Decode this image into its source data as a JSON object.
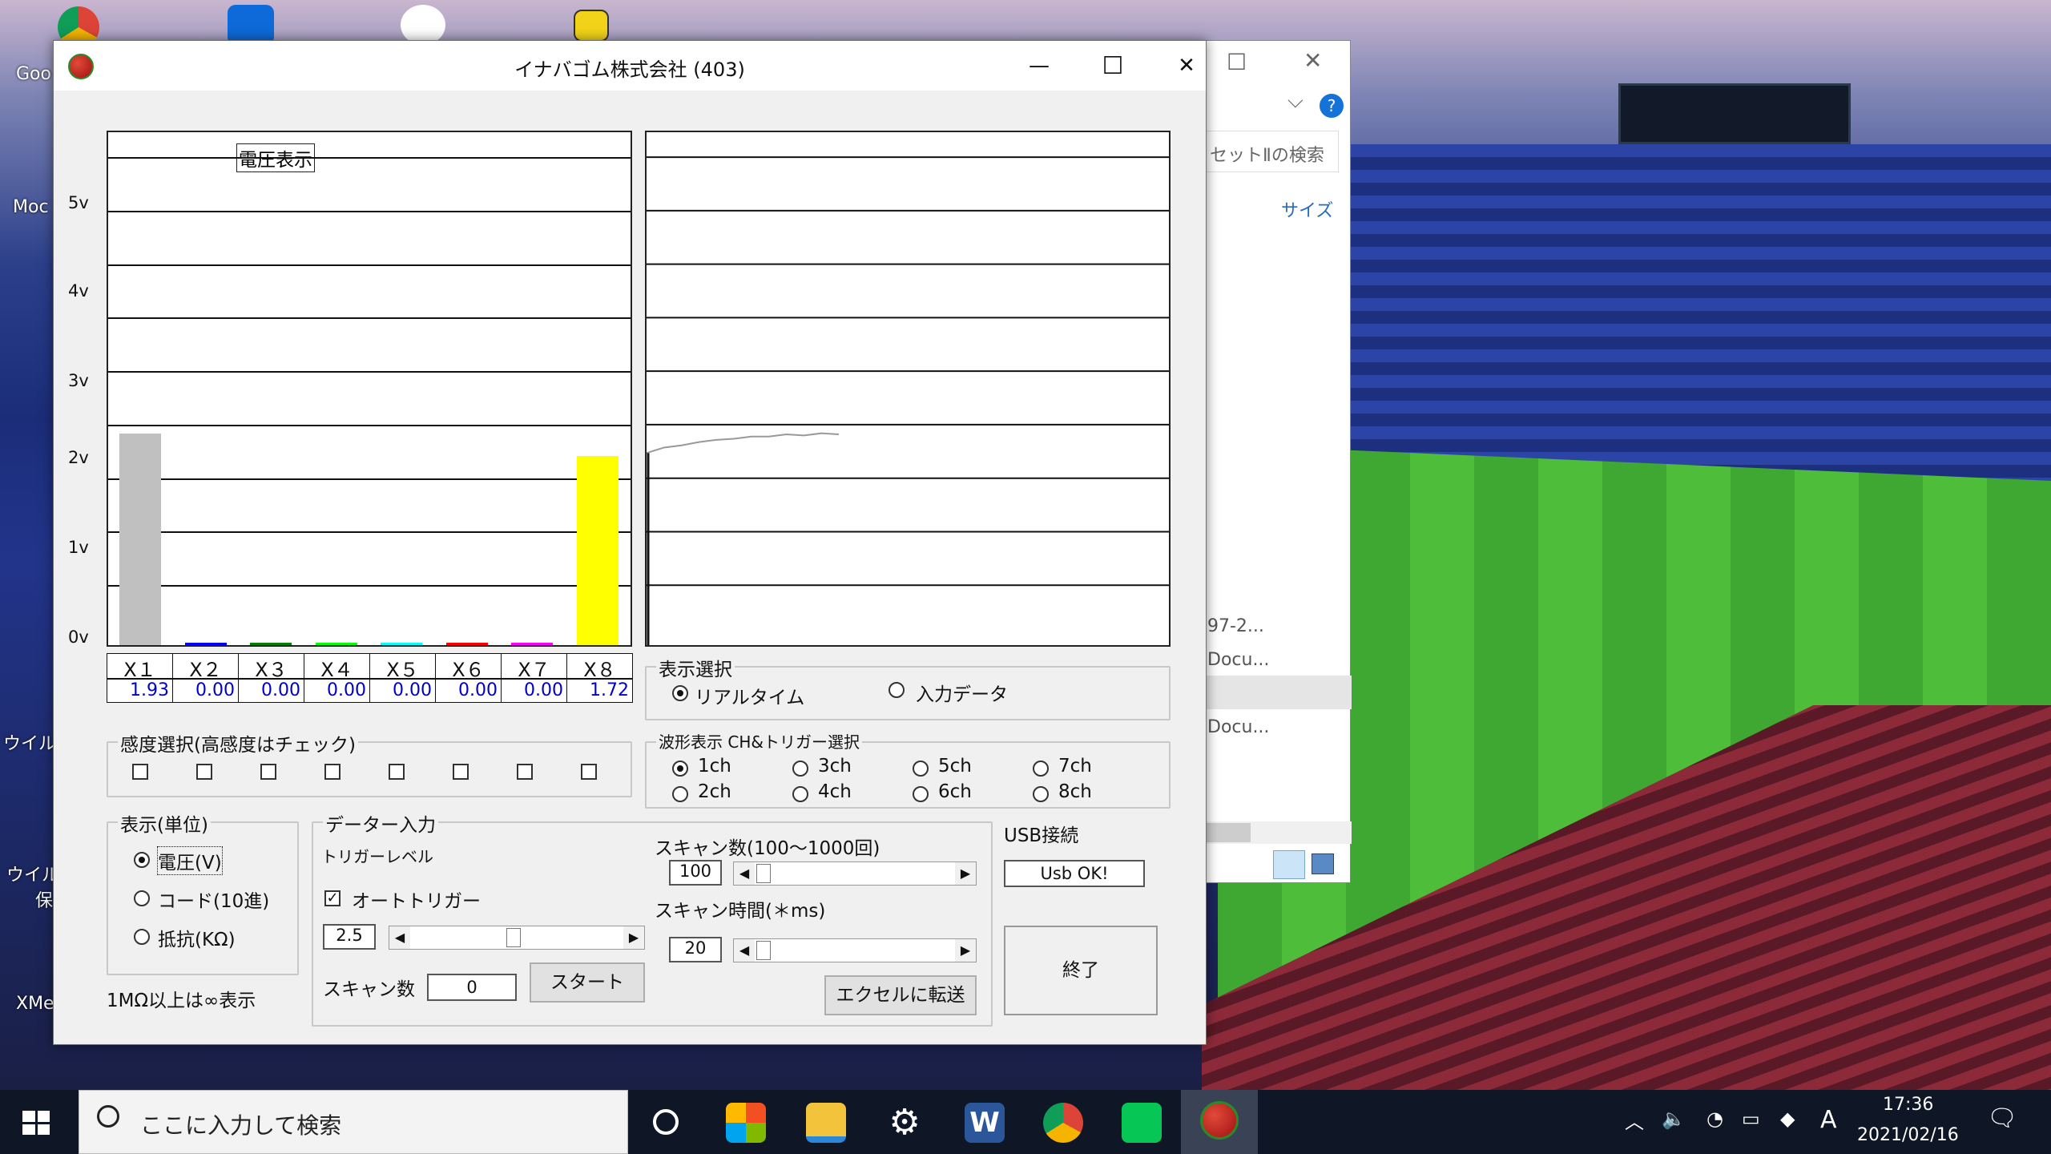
{
  "desktop": {
    "labels": [
      "Goo",
      "Moc",
      "ウイル",
      "ウイル",
      "保",
      "XMe"
    ]
  },
  "explorer": {
    "search_placeholder": "セットⅡの検索",
    "size_column": "サイズ",
    "items": [
      "97-2...",
      "Docu...",
      "Docu..."
    ],
    "help": "?",
    "chevron": "⌵"
  },
  "window": {
    "title": "イナバゴム株式会社 (403)",
    "minimize": "—",
    "maximize": "☐",
    "close": "✕"
  },
  "bar_chart": {
    "label": "電圧表示",
    "y_ticks": [
      "5v",
      "4v",
      "3v",
      "2v",
      "1v",
      "0v"
    ]
  },
  "chart_data": [
    {
      "type": "bar",
      "title": "電圧表示",
      "categories": [
        "X1",
        "X2",
        "X3",
        "X4",
        "X5",
        "X6",
        "X7",
        "X8"
      ],
      "values": [
        1.93,
        0.0,
        0.0,
        0.0,
        0.0,
        0.0,
        0.0,
        1.72
      ],
      "colors": [
        "#c0c0c0",
        "#0000ff",
        "#008000",
        "#00ff00",
        "#00ffff",
        "#ff0000",
        "#ff00ff",
        "#ffff00"
      ],
      "y_ticks": [
        "5v",
        "4v",
        "3v",
        "2v",
        "1v",
        "0v"
      ],
      "ylim": [
        0,
        5
      ],
      "grid": true
    },
    {
      "type": "line",
      "series": [
        {
          "values": [
            1.75,
            1.8,
            1.82,
            1.85,
            1.87,
            1.88,
            1.9,
            1.9,
            1.92,
            1.91,
            1.93,
            1.92
          ]
        }
      ],
      "ylim": [
        0,
        5
      ],
      "grid": true
    }
  ],
  "channels": {
    "names": [
      "X１",
      "X２",
      "X３",
      "X４",
      "X５",
      "X６",
      "X７",
      "X８"
    ],
    "values": [
      "1.93",
      "0.00",
      "0.00",
      "0.00",
      "0.00",
      "0.00",
      "0.00",
      "1.72"
    ]
  },
  "sensitivity": {
    "label": "感度選択(高感度はチェック)",
    "checked": [
      false,
      false,
      false,
      false,
      false,
      false,
      false,
      false
    ]
  },
  "display_unit": {
    "label": "表示(単位)",
    "options": [
      "電圧(V)",
      "コード(10進)",
      "抵抗(KΩ)"
    ],
    "selected": 0,
    "note": "1MΩ以上は∞表示"
  },
  "view_select": {
    "label": "表示選択",
    "options": [
      "リアルタイム",
      "入力データ"
    ],
    "selected": 0
  },
  "waveform": {
    "label": "波形表示 CH&トリガー選択",
    "options": [
      "1ch",
      "3ch",
      "5ch",
      "7ch",
      "2ch",
      "4ch",
      "6ch",
      "8ch"
    ],
    "selected": 0
  },
  "data_input": {
    "label": "データー入力",
    "trigger_level_label": "トリガーレベル",
    "auto_trigger_label": "オートトリガー",
    "auto_trigger_checked": true,
    "trigger_value": "2.5",
    "scan_count_label": "スキャン数",
    "scan_count_value": "0",
    "start_button": "スタート",
    "scan_num_label": "スキャン数(100～1000回)",
    "scan_num_value": "100",
    "scan_time_label": "スキャン時間(＊ms)",
    "scan_time_value": "20",
    "excel_button": "エクセルに転送"
  },
  "usb": {
    "label": "USB接続",
    "status": "Usb OK!"
  },
  "exit_button": "終了",
  "taskbar": {
    "search_placeholder": "ここに入力して検索",
    "time": "17:36",
    "date": "2021/02/16",
    "ime": "A"
  }
}
